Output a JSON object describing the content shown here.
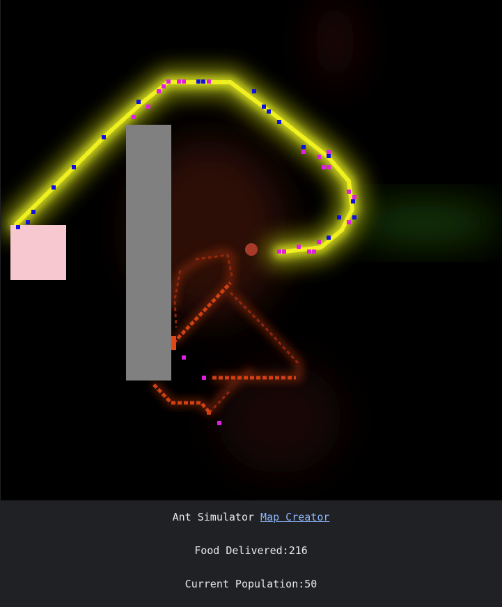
{
  "app": {
    "title": "Ant Simulator",
    "map_creator_link": "Map Creator"
  },
  "stats": {
    "food_label": "Food Delivered:",
    "food_value": "216",
    "population_label": "Current Population:",
    "population_value": "50"
  },
  "colors": {
    "background": "#000000",
    "panel": "#202124",
    "wall": "#808080",
    "nest": "#f8c8d0",
    "food_source": "#a83a2a",
    "food_trail": "#f0f020",
    "home_trail": "#d04010",
    "ant_searching": "#1010e0",
    "ant_carrying": "#e020e0",
    "link": "#8ab4f8"
  }
}
